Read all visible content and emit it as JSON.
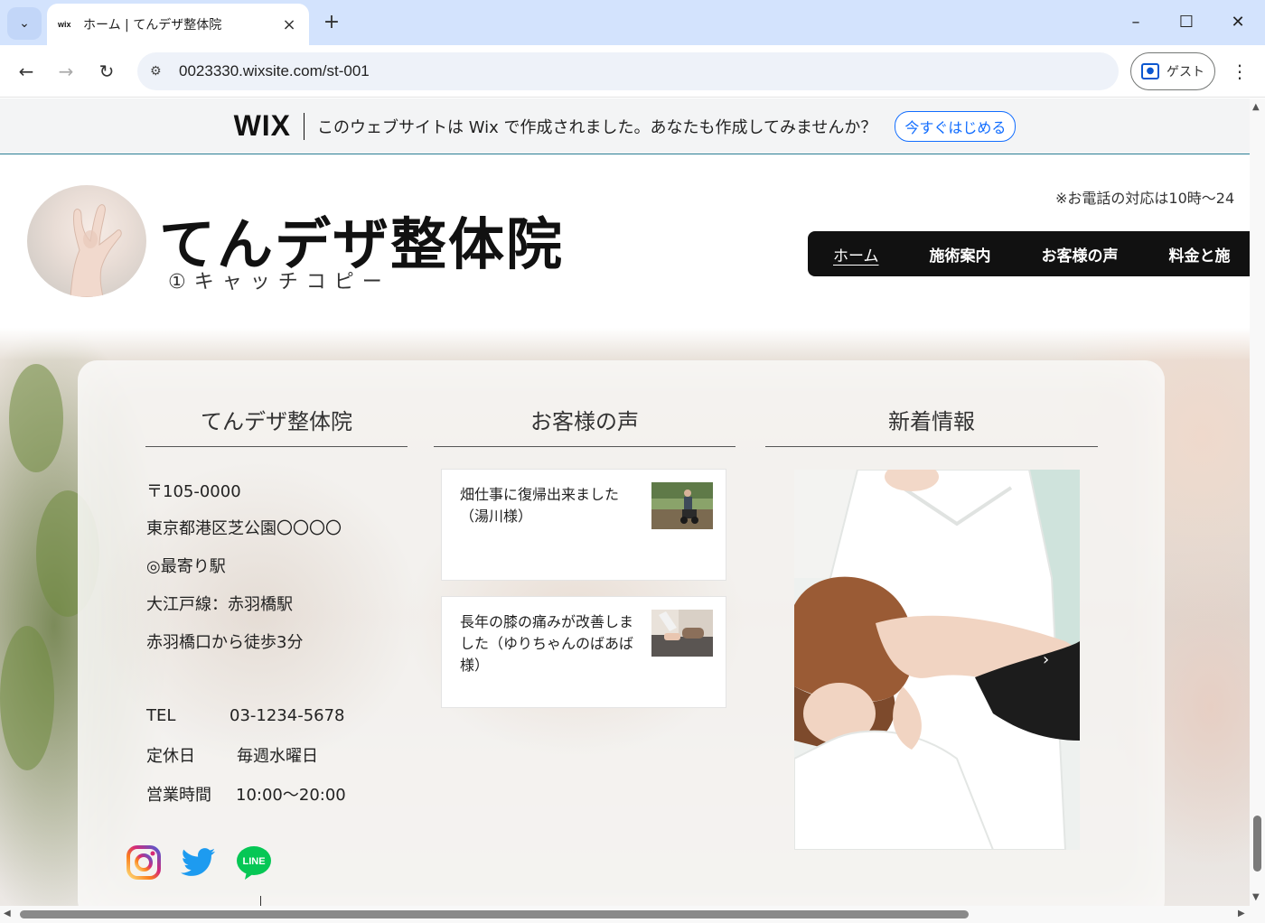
{
  "browser": {
    "tab_favicon": "wix",
    "tab_title": "ホーム | てんデザ整体院",
    "url": "0023330.wixsite.com/st-001",
    "guest_label": "ゲスト"
  },
  "wix_banner": {
    "logo": "WIX",
    "text": "このウェブサイトは Wix で作成されました。あなたも作成してみませんか？",
    "cta": "今すぐはじめる"
  },
  "header": {
    "site_title": "てんデザ整体院",
    "catch_copy": "①キャッチコピー",
    "phone_note": "※お電話の対応は10時～24",
    "nav": [
      {
        "label": "ホーム",
        "active": true
      },
      {
        "label": "施術案内",
        "active": false
      },
      {
        "label": "お客様の声",
        "active": false
      },
      {
        "label": "料金と施",
        "active": false
      }
    ]
  },
  "info": {
    "title": "てんデザ整体院",
    "address": [
      "〒105-0000",
      "東京都港区芝公園〇〇〇〇",
      "◎最寄り駅",
      "大江戸線：赤羽橋駅",
      "赤羽橋口から徒歩3分"
    ],
    "tel_label": "TEL",
    "tel_value": "03-1234-5678",
    "holiday_label": "定休日",
    "holiday_value": "毎週水曜日",
    "hours_label": "営業時間",
    "hours_value": "10:00～20:00"
  },
  "voices": {
    "title": "お客様の声",
    "items": [
      {
        "text": "畑仕事に復帰出来ました（湯川様）"
      },
      {
        "text": "長年の膝の痛みが改善しました（ゆりちゃんのばあば様）"
      }
    ]
  },
  "news": {
    "title": "新着情報",
    "next_arrow": "›"
  },
  "social_icons": [
    "instagram-icon",
    "twitter-icon",
    "line-icon"
  ],
  "social_line_text": "LINE",
  "colors": {
    "wix_blue": "#116dff",
    "nav_bg": "#111111",
    "chrome_tab_bg": "#d3e3fd"
  }
}
